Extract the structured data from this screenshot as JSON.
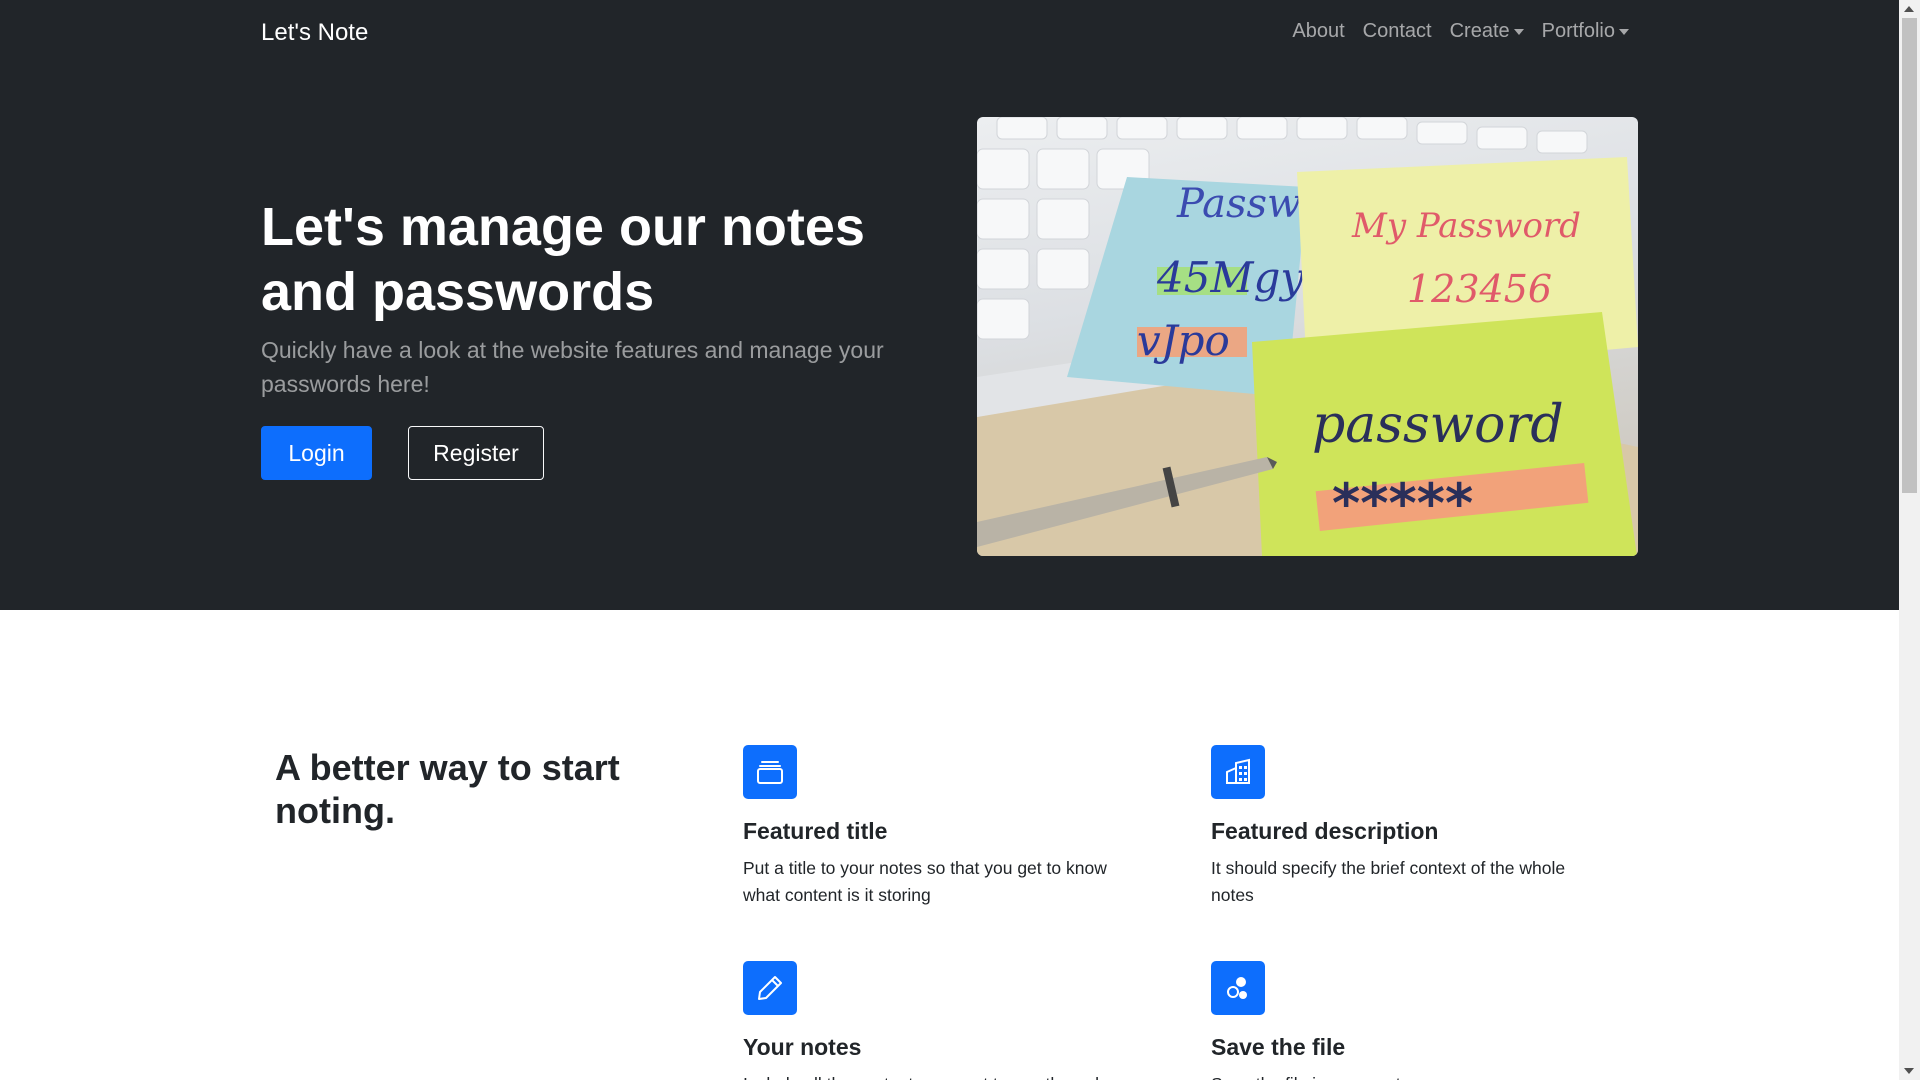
{
  "navbar": {
    "brand": "Let's Note",
    "links": [
      {
        "label": "About"
      },
      {
        "label": "Contact"
      },
      {
        "label": "Create",
        "dropdown": true
      },
      {
        "label": "Portfolio",
        "dropdown": true
      }
    ]
  },
  "hero": {
    "title": "Let's manage our notes and passwords",
    "lead": "Quickly have a look at the website features and manage your passwords here!",
    "login_label": "Login",
    "register_label": "Register",
    "image": {
      "note1_line1": "Passwo",
      "note1_line2": "45Mgy",
      "note1_line3": "vJpo",
      "note2_line1": "My Password",
      "note2_line2": "123456",
      "note3_line1": "password",
      "note3_line2": "*****"
    }
  },
  "features": {
    "heading": "A better way to start noting.",
    "items": [
      {
        "icon": "collection-icon",
        "title": "Featured title",
        "text": "Put a title to your notes so that you get to know what content is it storing"
      },
      {
        "icon": "building-icon",
        "title": "Featured description",
        "text": "It should specify the brief context of the whole notes"
      },
      {
        "icon": "pencil-icon",
        "title": "Your notes",
        "text": "Include all the content you want to see through..."
      },
      {
        "icon": "share-icon",
        "title": "Save the file",
        "text": "Save the file in your system..."
      }
    ]
  },
  "colors": {
    "dark_bg": "#212529",
    "primary": "#0d6efd"
  }
}
